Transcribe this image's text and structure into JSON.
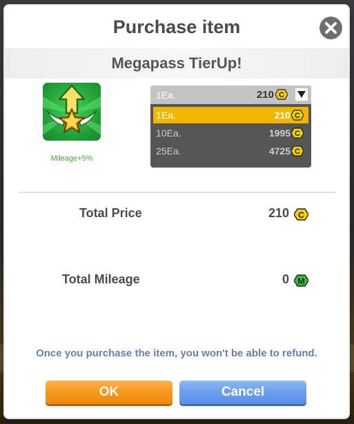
{
  "dialog": {
    "title": "Purchase item",
    "item_name": "Megapass TierUp!",
    "item_icon": "star-tier-up-icon",
    "mileage_bonus": "Mileage+5%"
  },
  "quantity": {
    "selected_label": "1Ea.",
    "selected_price": "210",
    "options": [
      {
        "label": "1Ea.",
        "price": "210",
        "selected": true
      },
      {
        "label": "10Ea.",
        "price": "1995",
        "selected": false
      },
      {
        "label": "25Ea.",
        "price": "4725",
        "selected": false
      }
    ]
  },
  "summary": {
    "total_price_label": "Total Price",
    "total_price_value": "210",
    "total_price_currency_icon": "coin-icon",
    "total_mileage_label": "Total Mileage",
    "total_mileage_value": "0",
    "total_mileage_currency_icon": "mileage-icon"
  },
  "notice": "Once you purchase the item, you won't be able to refund.",
  "buttons": {
    "ok": "OK",
    "cancel": "Cancel"
  },
  "colors": {
    "ok_button": "#f89a1f",
    "cancel_button": "#6d9fef",
    "selected_option": "#f2b500",
    "coin": "#f5d000",
    "mileage": "#2fbf3a"
  }
}
